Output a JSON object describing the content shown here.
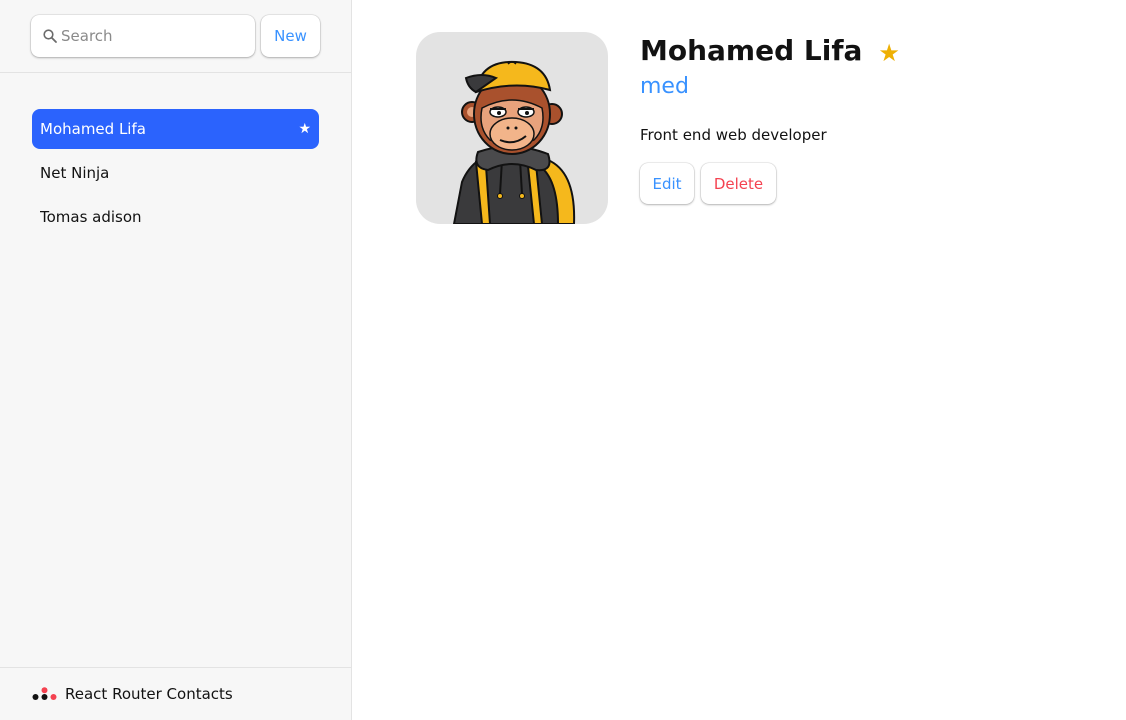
{
  "sidebar": {
    "search": {
      "placeholder": "Search",
      "value": ""
    },
    "new_label": "New",
    "contacts": [
      {
        "name": "Mohamed Lifa",
        "favorite_icon": "★",
        "active": true
      },
      {
        "name": "Net Ninja",
        "favorite_icon": "",
        "active": false
      },
      {
        "name": "Tomas adison",
        "favorite_icon": "",
        "active": false
      }
    ],
    "footer": {
      "title": "React Router Contacts",
      "logo": "react-router-logo"
    }
  },
  "contact": {
    "name": "Mohamed Lifa",
    "favorite_icon": "★",
    "favorite": true,
    "handle": "med",
    "notes": "Front end web developer",
    "avatar": "avatar-image-ape-cartoon",
    "edit_label": "Edit",
    "delete_label": "Delete"
  },
  "colors": {
    "accent": "#3992ff",
    "active_item": "#2b6cfc",
    "favorite": "#eeb004",
    "danger": "#f44250"
  }
}
